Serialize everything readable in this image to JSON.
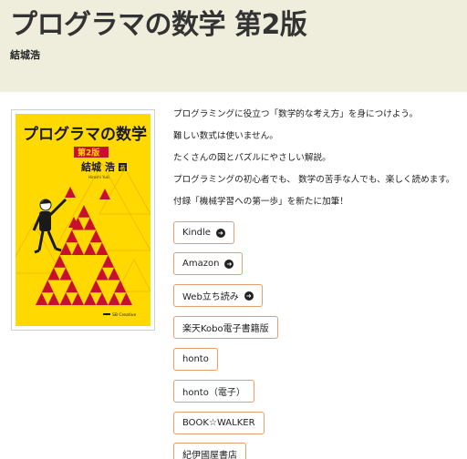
{
  "header": {
    "title": "プログラマの数学 第2版",
    "author": "結城浩"
  },
  "cover": {
    "title": "プログラマの数学",
    "edition": "第2版",
    "author": "結城 浩",
    "author_suffix": "著",
    "author_roman": "Hiroshi Yuki",
    "publisher": "SB Creative",
    "background": "#ffd900",
    "accent": "#c8102e"
  },
  "description": [
    "プログラミングに役立つ「数学的な考え方」を身につけよう。",
    "難しい数式は使いません。",
    "たくさんの図とパズルにやさしい解説。",
    "プログラミングの初心者でも、 数学の苦手な人でも、楽しく読めます。",
    "付録「機械学習への第一歩」を新たに加筆！"
  ],
  "buttons": [
    {
      "label": "Kindle",
      "icon": "arrow-circle-right-icon"
    },
    {
      "label": "Amazon",
      "icon": "arrow-circle-right-icon"
    },
    {
      "label": "Web立ち読み",
      "icon": "arrow-circle-right-icon"
    },
    {
      "label": "楽天Kobo電子書籍版",
      "icon": ""
    },
    {
      "label": "honto",
      "icon": ""
    },
    {
      "label": "honto（電子）",
      "icon": ""
    },
    {
      "label": "BOOK☆WALKER",
      "icon": ""
    },
    {
      "label": "紀伊國屋書店",
      "icon": ""
    }
  ],
  "colors": {
    "header_bg": "#efeedd",
    "button_border": "#e59e6e"
  }
}
